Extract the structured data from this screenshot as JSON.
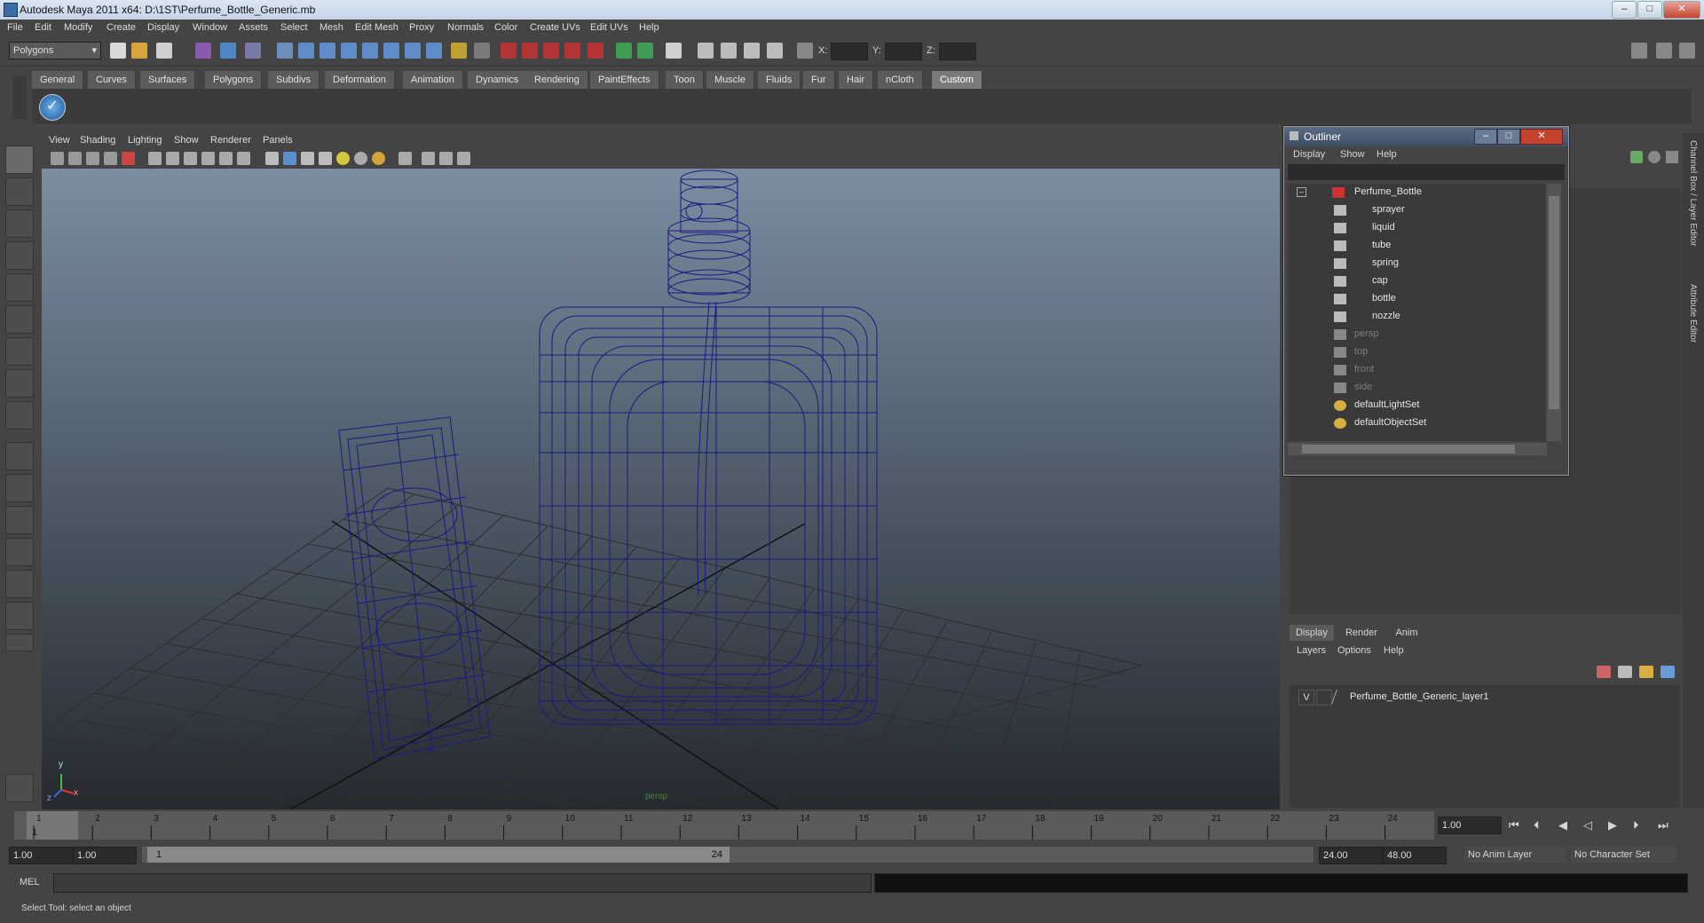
{
  "window": {
    "title": "Autodesk Maya 2011 x64: D:\\1ST\\Perfume_Bottle_Generic.mb",
    "min": "–",
    "max": "□",
    "close": "✕"
  },
  "menu": [
    "File",
    "Edit",
    "Modify",
    "Create",
    "Display",
    "Window",
    "Assets",
    "Select",
    "Mesh",
    "Edit Mesh",
    "Proxy",
    "Normals",
    "Color",
    "Create UVs",
    "Edit UVs",
    "Help"
  ],
  "toolbar": {
    "mode": "Polygons",
    "x_label": "X:",
    "y_label": "Y:",
    "z_label": "Z:"
  },
  "shelf_tabs": [
    "General",
    "Curves",
    "Surfaces",
    "Polygons",
    "Subdivs",
    "Deformation",
    "Animation",
    "Dynamics",
    "Rendering",
    "PaintEffects",
    "Toon",
    "Muscle",
    "Fluids",
    "Fur",
    "Hair",
    "nCloth",
    "Custom"
  ],
  "shelf_active": "Custom",
  "viewport_menu": [
    "View",
    "Shading",
    "Lighting",
    "Show",
    "Renderer",
    "Panels"
  ],
  "viewport": {
    "axis_x": "x",
    "axis_y": "y",
    "axis_z": "z",
    "camera": "persp"
  },
  "outliner": {
    "title": "Outliner",
    "menu": [
      "Display",
      "Show",
      "Help"
    ],
    "items": [
      {
        "label": "Perfume_Bottle",
        "dim": false,
        "indent": 0
      },
      {
        "label": "sprayer",
        "dim": false,
        "indent": 1
      },
      {
        "label": "liquid",
        "dim": false,
        "indent": 1
      },
      {
        "label": "tube",
        "dim": false,
        "indent": 1
      },
      {
        "label": "spring",
        "dim": false,
        "indent": 1
      },
      {
        "label": "cap",
        "dim": false,
        "indent": 1
      },
      {
        "label": "bottle",
        "dim": false,
        "indent": 1
      },
      {
        "label": "nozzle",
        "dim": false,
        "indent": 1
      },
      {
        "label": "persp",
        "dim": true,
        "indent": 0
      },
      {
        "label": "top",
        "dim": true,
        "indent": 0
      },
      {
        "label": "front",
        "dim": true,
        "indent": 0
      },
      {
        "label": "side",
        "dim": true,
        "indent": 0
      },
      {
        "label": "defaultLightSet",
        "dim": false,
        "indent": 0
      },
      {
        "label": "defaultObjectSet",
        "dim": false,
        "indent": 0
      }
    ]
  },
  "side_tabs": [
    "Channel Box / Layer Editor",
    "Attribute Editor"
  ],
  "layer_editor": {
    "tabs": [
      "Display",
      "Render",
      "Anim"
    ],
    "menu": [
      "Layers",
      "Options",
      "Help"
    ],
    "layer_v": "V",
    "layer_name": "Perfume_Bottle_Generic_layer1"
  },
  "timeline": {
    "ticks": [
      "1",
      "2",
      "3",
      "4",
      "5",
      "6",
      "7",
      "8",
      "9",
      "10",
      "11",
      "12",
      "13",
      "14",
      "15",
      "16",
      "17",
      "18",
      "19",
      "20",
      "21",
      "22",
      "23",
      "24"
    ],
    "current_frame": "1",
    "current_field": "1.00"
  },
  "range": {
    "start": "1.00",
    "anim_start": "1.00",
    "slider_start": "1",
    "slider_end": "24",
    "anim_end": "24.00",
    "end": "48.00",
    "anim_layer": "No Anim Layer",
    "char_set": "No Character Set"
  },
  "cmd": {
    "label": "MEL"
  },
  "help_line": "Select Tool: select an object",
  "colors": {
    "wireframe": "#1a1a80",
    "grid": "#2a2a2a",
    "bg": "#444444"
  }
}
